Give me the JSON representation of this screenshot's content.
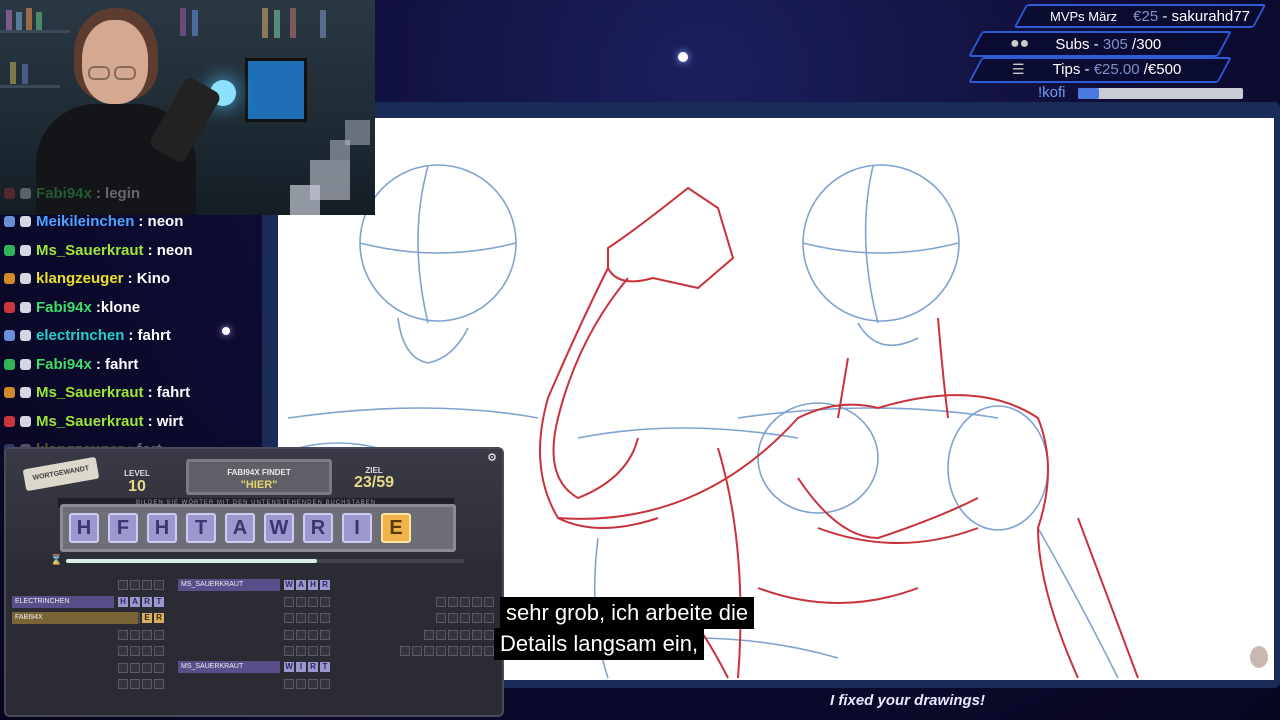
{
  "widget": {
    "mvp_label": "MVPs März",
    "mvp_amount": "€25",
    "mvp_sep": " - ",
    "mvp_name": "sakurahd77",
    "subs_label": "Subs - ",
    "subs_current": "305",
    "subs_goal": " /300",
    "tips_label": "Tips - ",
    "tips_current": "€25.00",
    "tips_goal": " /€500",
    "kofi_label": "!kofi",
    "kofi_progress": 0.05
  },
  "chat": [
    {
      "user": "Fabi94x",
      "msg": ": legin",
      "color": "#3fdc6a",
      "faded": true
    },
    {
      "user": "Meikileinchen",
      "msg": ": neon",
      "color": "#4fa3ff"
    },
    {
      "user": "Ms_Sauerkraut",
      "msg": ": neon",
      "color": "#9ee63a"
    },
    {
      "user": "klangzeuger",
      "msg": ": Kino",
      "color": "#e7e12a"
    },
    {
      "user": "Fabi94x",
      "msg": " :klone",
      "color": "#3fdc6a"
    },
    {
      "user": "electrinchen",
      "msg": ": fahrt",
      "color": "#25d0c9"
    },
    {
      "user": "Fabi94x",
      "msg": ": fahrt",
      "color": "#3fdc6a"
    },
    {
      "user": "Ms_Sauerkraut",
      "msg": ": fahrt",
      "color": "#9ee63a"
    },
    {
      "user": "Ms_Sauerkraut",
      "msg": ": wirt",
      "color": "#9ee63a"
    },
    {
      "user": "klangzeuger",
      "msg": ": fort",
      "color": "#e7e12a",
      "faded": true
    }
  ],
  "game": {
    "logo": "WORTGEWANDT",
    "level_label": "LEVEL",
    "level_value": "10",
    "finder_title": "FABI94X FINDET",
    "finder_word": "\"HIER\"",
    "goal_label": "ZIEL",
    "goal_value": "23/59",
    "banner": "BILDEN SIE WÖRTER MIT DEN UNTENSTEHENDEN BUCHSTABEN",
    "tiles": [
      "H",
      "F",
      "H",
      "T",
      "A",
      "W",
      "R",
      "I",
      "E"
    ],
    "timer_progress": 0.63,
    "found": [
      {
        "name": "ELECTRINCHEN",
        "word": "HART"
      },
      {
        "name": "FABI94X",
        "word": "ER"
      },
      {
        "name": "MS_SAUERKRAUT",
        "word": "WAHR"
      },
      {
        "name": "MS_SAUERKRAUT",
        "word": "WIRT"
      }
    ]
  },
  "subtitles": [
    "sehr grob, ich arbeite die",
    "Details langsam ein,"
  ],
  "footer_text": "I fixed your drawings!",
  "colors": {
    "accent": "#2f5bd6",
    "sketch_red": "#c8323a",
    "sketch_blue": "#6a92c8"
  }
}
